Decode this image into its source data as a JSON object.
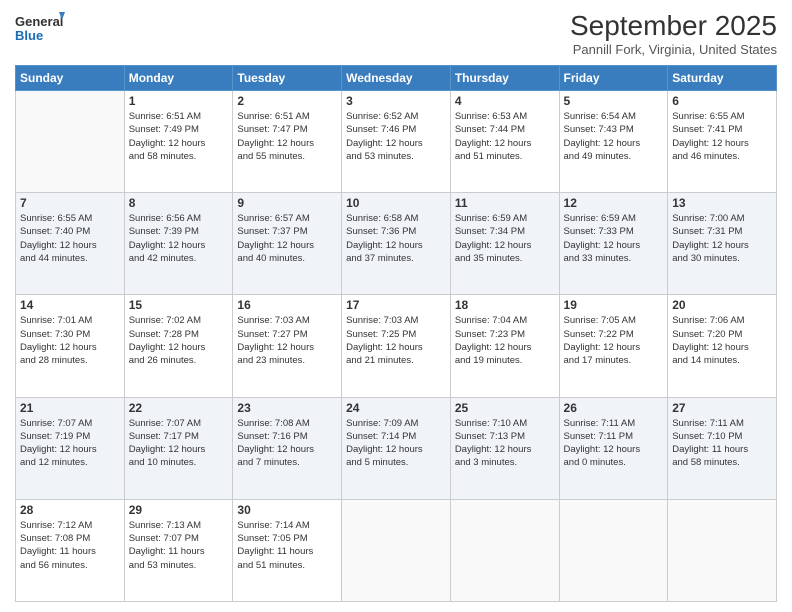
{
  "header": {
    "logo_line1": "General",
    "logo_line2": "Blue",
    "month_title": "September 2025",
    "location": "Pannill Fork, Virginia, United States"
  },
  "weekdays": [
    "Sunday",
    "Monday",
    "Tuesday",
    "Wednesday",
    "Thursday",
    "Friday",
    "Saturday"
  ],
  "weeks": [
    [
      {
        "day": "",
        "info": ""
      },
      {
        "day": "1",
        "info": "Sunrise: 6:51 AM\nSunset: 7:49 PM\nDaylight: 12 hours\nand 58 minutes."
      },
      {
        "day": "2",
        "info": "Sunrise: 6:51 AM\nSunset: 7:47 PM\nDaylight: 12 hours\nand 55 minutes."
      },
      {
        "day": "3",
        "info": "Sunrise: 6:52 AM\nSunset: 7:46 PM\nDaylight: 12 hours\nand 53 minutes."
      },
      {
        "day": "4",
        "info": "Sunrise: 6:53 AM\nSunset: 7:44 PM\nDaylight: 12 hours\nand 51 minutes."
      },
      {
        "day": "5",
        "info": "Sunrise: 6:54 AM\nSunset: 7:43 PM\nDaylight: 12 hours\nand 49 minutes."
      },
      {
        "day": "6",
        "info": "Sunrise: 6:55 AM\nSunset: 7:41 PM\nDaylight: 12 hours\nand 46 minutes."
      }
    ],
    [
      {
        "day": "7",
        "info": "Sunrise: 6:55 AM\nSunset: 7:40 PM\nDaylight: 12 hours\nand 44 minutes."
      },
      {
        "day": "8",
        "info": "Sunrise: 6:56 AM\nSunset: 7:39 PM\nDaylight: 12 hours\nand 42 minutes."
      },
      {
        "day": "9",
        "info": "Sunrise: 6:57 AM\nSunset: 7:37 PM\nDaylight: 12 hours\nand 40 minutes."
      },
      {
        "day": "10",
        "info": "Sunrise: 6:58 AM\nSunset: 7:36 PM\nDaylight: 12 hours\nand 37 minutes."
      },
      {
        "day": "11",
        "info": "Sunrise: 6:59 AM\nSunset: 7:34 PM\nDaylight: 12 hours\nand 35 minutes."
      },
      {
        "day": "12",
        "info": "Sunrise: 6:59 AM\nSunset: 7:33 PM\nDaylight: 12 hours\nand 33 minutes."
      },
      {
        "day": "13",
        "info": "Sunrise: 7:00 AM\nSunset: 7:31 PM\nDaylight: 12 hours\nand 30 minutes."
      }
    ],
    [
      {
        "day": "14",
        "info": "Sunrise: 7:01 AM\nSunset: 7:30 PM\nDaylight: 12 hours\nand 28 minutes."
      },
      {
        "day": "15",
        "info": "Sunrise: 7:02 AM\nSunset: 7:28 PM\nDaylight: 12 hours\nand 26 minutes."
      },
      {
        "day": "16",
        "info": "Sunrise: 7:03 AM\nSunset: 7:27 PM\nDaylight: 12 hours\nand 23 minutes."
      },
      {
        "day": "17",
        "info": "Sunrise: 7:03 AM\nSunset: 7:25 PM\nDaylight: 12 hours\nand 21 minutes."
      },
      {
        "day": "18",
        "info": "Sunrise: 7:04 AM\nSunset: 7:23 PM\nDaylight: 12 hours\nand 19 minutes."
      },
      {
        "day": "19",
        "info": "Sunrise: 7:05 AM\nSunset: 7:22 PM\nDaylight: 12 hours\nand 17 minutes."
      },
      {
        "day": "20",
        "info": "Sunrise: 7:06 AM\nSunset: 7:20 PM\nDaylight: 12 hours\nand 14 minutes."
      }
    ],
    [
      {
        "day": "21",
        "info": "Sunrise: 7:07 AM\nSunset: 7:19 PM\nDaylight: 12 hours\nand 12 minutes."
      },
      {
        "day": "22",
        "info": "Sunrise: 7:07 AM\nSunset: 7:17 PM\nDaylight: 12 hours\nand 10 minutes."
      },
      {
        "day": "23",
        "info": "Sunrise: 7:08 AM\nSunset: 7:16 PM\nDaylight: 12 hours\nand 7 minutes."
      },
      {
        "day": "24",
        "info": "Sunrise: 7:09 AM\nSunset: 7:14 PM\nDaylight: 12 hours\nand 5 minutes."
      },
      {
        "day": "25",
        "info": "Sunrise: 7:10 AM\nSunset: 7:13 PM\nDaylight: 12 hours\nand 3 minutes."
      },
      {
        "day": "26",
        "info": "Sunrise: 7:11 AM\nSunset: 7:11 PM\nDaylight: 12 hours\nand 0 minutes."
      },
      {
        "day": "27",
        "info": "Sunrise: 7:11 AM\nSunset: 7:10 PM\nDaylight: 11 hours\nand 58 minutes."
      }
    ],
    [
      {
        "day": "28",
        "info": "Sunrise: 7:12 AM\nSunset: 7:08 PM\nDaylight: 11 hours\nand 56 minutes."
      },
      {
        "day": "29",
        "info": "Sunrise: 7:13 AM\nSunset: 7:07 PM\nDaylight: 11 hours\nand 53 minutes."
      },
      {
        "day": "30",
        "info": "Sunrise: 7:14 AM\nSunset: 7:05 PM\nDaylight: 11 hours\nand 51 minutes."
      },
      {
        "day": "",
        "info": ""
      },
      {
        "day": "",
        "info": ""
      },
      {
        "day": "",
        "info": ""
      },
      {
        "day": "",
        "info": ""
      }
    ]
  ]
}
